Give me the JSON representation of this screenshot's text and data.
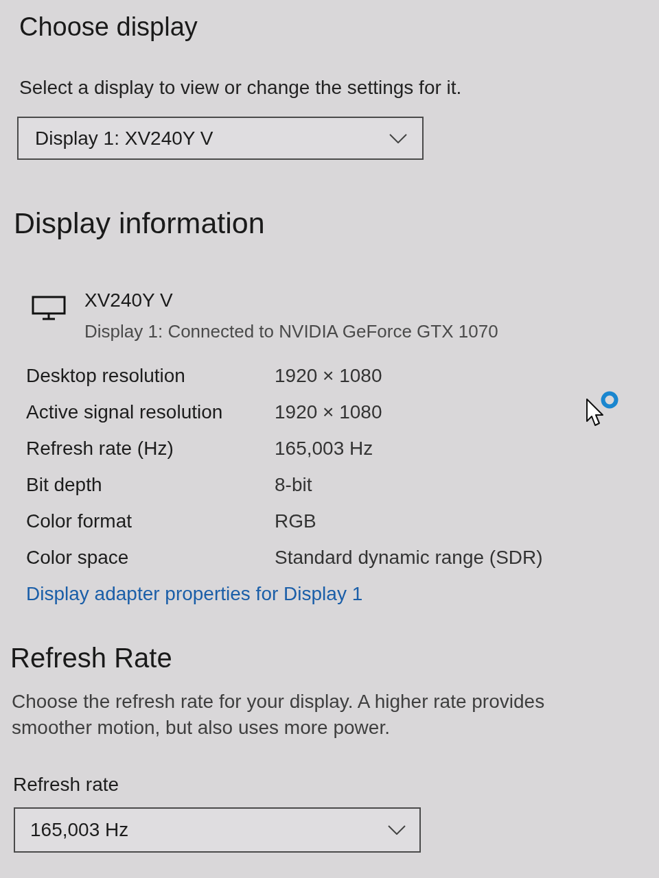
{
  "choose_display": {
    "heading": "Choose display",
    "description": "Select a display to view or change the settings for it.",
    "dropdown": {
      "value": "Display 1: XV240Y V"
    }
  },
  "display_information": {
    "heading": "Display information",
    "monitor": {
      "name": "XV240Y V",
      "connection": "Display 1: Connected to NVIDIA GeForce GTX 1070"
    },
    "properties": [
      {
        "label": "Desktop resolution",
        "value": "1920 × 1080"
      },
      {
        "label": "Active signal resolution",
        "value": "1920 × 1080"
      },
      {
        "label": "Refresh rate (Hz)",
        "value": "165,003 Hz"
      },
      {
        "label": "Bit depth",
        "value": "8-bit"
      },
      {
        "label": "Color format",
        "value": "RGB"
      },
      {
        "label": "Color space",
        "value": "Standard dynamic range (SDR)"
      }
    ],
    "link": "Display adapter properties for Display 1"
  },
  "refresh_rate": {
    "heading": "Refresh Rate",
    "description": "Choose the refresh rate for your display. A higher rate provides smoother motion, but also uses more power.",
    "field_label": "Refresh rate",
    "dropdown": {
      "value": "165,003 Hz"
    }
  }
}
